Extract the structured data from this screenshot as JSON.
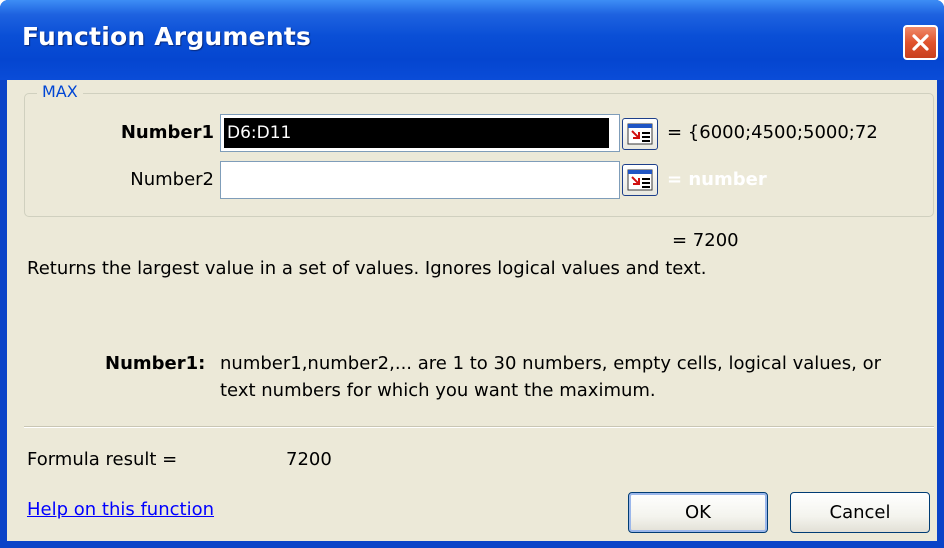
{
  "window": {
    "title": "Function Arguments"
  },
  "function_group": {
    "name": "MAX",
    "arguments": [
      {
        "label": "Number1",
        "value": "D6:D11",
        "evaluated": "= {6000;4500;5000;72"
      },
      {
        "label": "Number2",
        "value": "",
        "evaluated": "= number"
      }
    ]
  },
  "function_result": "= 7200",
  "description": "Returns the largest value in a set of values. Ignores logical values and text.",
  "arg_help": {
    "label": "Number1:",
    "line1": "number1,number2,... are 1 to 30 numbers, empty cells, logical values, or",
    "line2": "text numbers for which you want the maximum."
  },
  "formula_result": {
    "label": "Formula result =",
    "value": "7200"
  },
  "help_link": "Help on this function",
  "buttons": {
    "ok": "OK",
    "cancel": "Cancel"
  },
  "colors": {
    "titlebar": "#0a4fd6",
    "client_bg": "#ece9d8",
    "group_legend": "#0046d5",
    "link": "#0000ff",
    "close_button": "#e0532e"
  },
  "icons": {
    "close": "close-x-icon",
    "collapse": "collapse-dialog-icon"
  }
}
